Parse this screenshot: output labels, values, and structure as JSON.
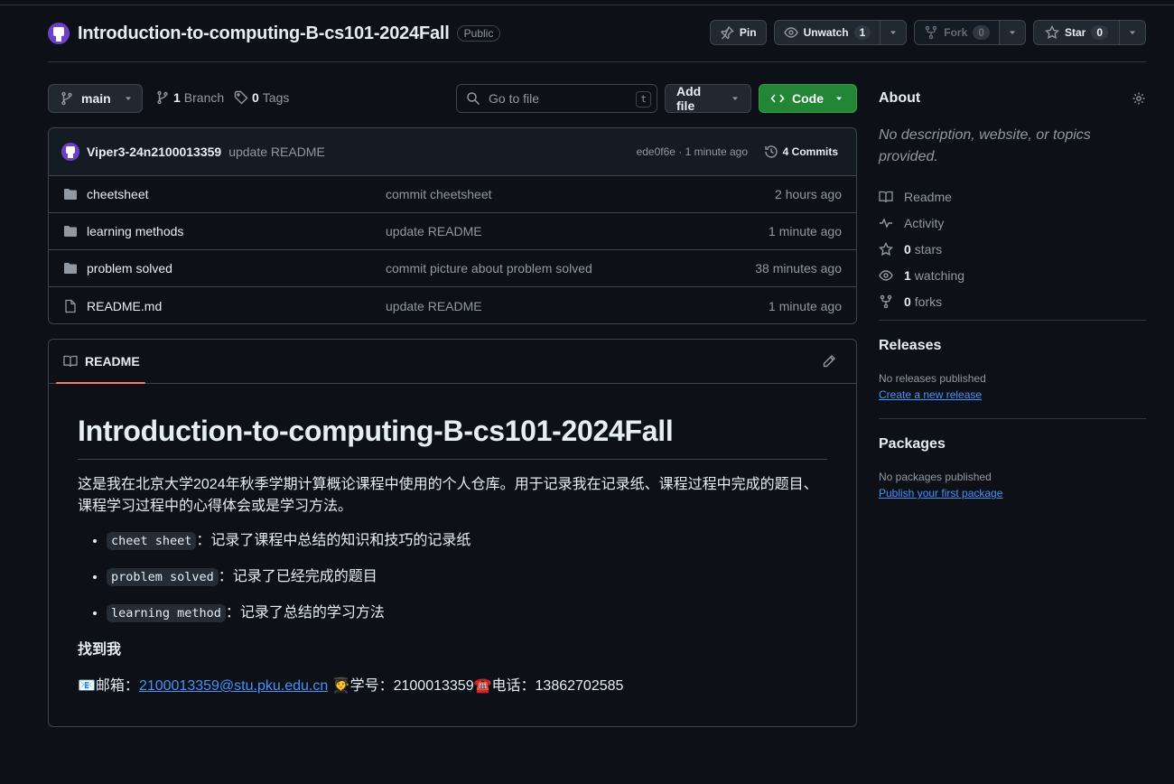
{
  "repo": {
    "name": "Introduction-to-computing-B-cs101-2024Fall",
    "visibility": "Public"
  },
  "actions": {
    "pin": "Pin",
    "unwatch": "Unwatch",
    "watch_count": "1",
    "fork": "Fork",
    "fork_count": "0",
    "star": "Star",
    "star_count": "0"
  },
  "toolbar": {
    "branch": "main",
    "branch_count": "1",
    "branch_label": "Branch",
    "tag_count": "0",
    "tag_label": "Tags",
    "goto_placeholder": "Go to file",
    "goto_shortcut": "t",
    "add_file": "Add file",
    "code": "Code"
  },
  "latest_commit": {
    "author": "Viper3-24n2100013359",
    "message": "update README",
    "meta": "ede0f6e · 1 minute ago",
    "commits": "4 Commits"
  },
  "files": [
    {
      "name": "cheetsheet",
      "type": "folder",
      "message": "commit cheetsheet",
      "time": "2 hours ago"
    },
    {
      "name": "learning methods",
      "type": "folder",
      "message": "update README",
      "time": "1 minute ago"
    },
    {
      "name": "problem solved",
      "type": "folder",
      "message": "commit picture about problem solved",
      "time": "38 minutes ago"
    },
    {
      "name": "README.md",
      "type": "file",
      "message": "update README",
      "time": "1 minute ago"
    }
  ],
  "readme": {
    "tab": "README",
    "title": "Introduction-to-computing-B-cs101-2024Fall",
    "intro": "这是我在北京大学2024年秋季学期计算概论课程中使用的个人仓库。用于记录我在记录纸、课程过程中完成的题目、课程学习过程中的心得体会或是学习方法。",
    "items": [
      {
        "code": "cheet sheet",
        "text": "：记录了课程中总结的知识和技巧的记录纸"
      },
      {
        "code": "problem solved",
        "text": "：记录了已经完成的题目"
      },
      {
        "code": "learning method",
        "text": "：记录了总结的学习方法"
      }
    ],
    "find_me": "找到我",
    "contact": {
      "email_prefix": "📧邮箱：",
      "email": "2100013359@stu.pku.edu.cn",
      "id_part": "🧑‍🎓学号：2100013359",
      "phone_part": "☎️电话：13862702585"
    }
  },
  "about": {
    "title": "About",
    "description": "No description, website, or topics provided.",
    "readme": "Readme",
    "activity": "Activity",
    "stars_count": "0",
    "stars_label": "stars",
    "watching_count": "1",
    "watching_label": "watching",
    "forks_count": "0",
    "forks_label": "forks"
  },
  "releases": {
    "title": "Releases",
    "status": "No releases published",
    "link": "Create a new release"
  },
  "packages": {
    "title": "Packages",
    "status": "No packages published",
    "link": "Publish your first package"
  },
  "colors": {
    "background": "#0d1117",
    "accent_green": "#238636",
    "link": "#4493f8",
    "tab_underline": "#f78166"
  }
}
